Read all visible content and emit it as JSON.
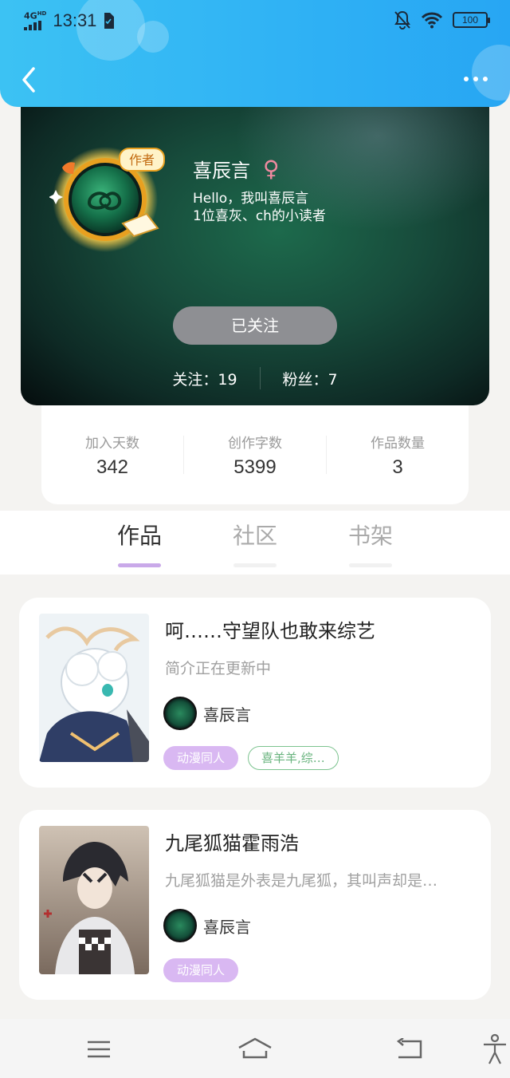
{
  "status_bar": {
    "network": "4G",
    "network_sup": "HD",
    "time": "13:31",
    "battery": "100"
  },
  "profile": {
    "badge": "作者",
    "name": "喜辰言",
    "gender_icon": "♀",
    "bio_line1": "Hello，我叫喜辰言",
    "bio_line2": "1位喜灰、ch的小读者",
    "follow_button": "已关注",
    "following_label": "关注：19",
    "fans_label": "粉丝：7"
  },
  "stats": [
    {
      "label": "加入天数",
      "value": "342"
    },
    {
      "label": "创作字数",
      "value": "5399"
    },
    {
      "label": "作品数量",
      "value": "3"
    }
  ],
  "tabs": [
    {
      "label": "作品",
      "active": true
    },
    {
      "label": "社区",
      "active": false
    },
    {
      "label": "书架",
      "active": false
    }
  ],
  "works": [
    {
      "title": "呵……守望队也敢来综艺",
      "desc": "简介正在更新中",
      "author": "喜辰言",
      "tags": [
        "动漫同人",
        "喜羊羊,综…"
      ]
    },
    {
      "title": "九尾狐猫霍雨浩",
      "desc": "九尾狐猫是外表是九尾狐，其叫声却是…",
      "author": "喜辰言",
      "tags": [
        "动漫同人"
      ]
    }
  ],
  "colors": {
    "header": "#2fb1f4",
    "accent": "#c9a9e9",
    "tag_purple": "#d9b8f2",
    "tag_green": "#7cc38f"
  },
  "icons": {
    "back": "back-icon",
    "more": "more-icon",
    "menu": "menu-icon",
    "home": "home-icon",
    "return": "return-icon",
    "accessibility": "accessibility-icon"
  }
}
